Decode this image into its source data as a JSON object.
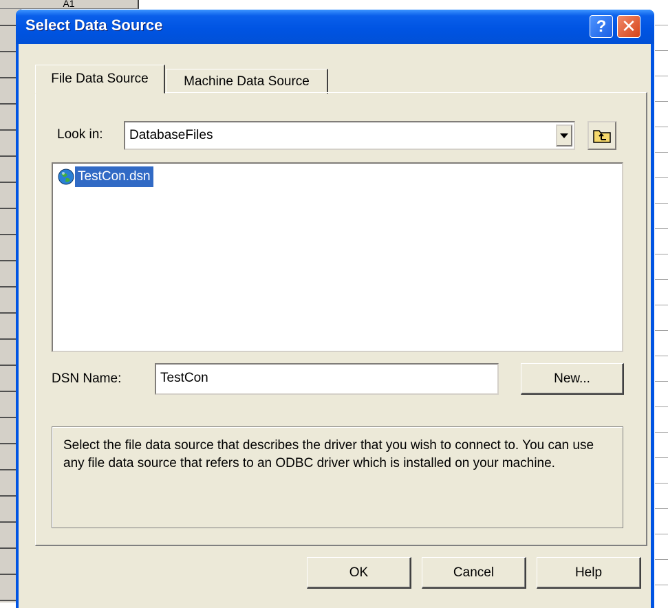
{
  "background": {
    "name_box_text": "A1"
  },
  "dialog": {
    "title": "Select Data Source",
    "help_glyph": "?",
    "close_glyph": "✕",
    "tabs": [
      {
        "label": "File Data Source",
        "selected": true
      },
      {
        "label": "Machine Data Source",
        "selected": false
      }
    ],
    "look_in": {
      "label": "Look in:",
      "value": "DatabaseFiles"
    },
    "file_list": [
      {
        "name": "TestCon.dsn",
        "icon": "globe-dsn-icon",
        "selected": true
      }
    ],
    "dsn_name": {
      "label": "DSN Name:",
      "value": "TestCon"
    },
    "new_button": "New...",
    "description": "Select the file data source that describes the driver that you wish to connect to. You can use any file data source that refers to an ODBC driver which is installed on your machine.",
    "buttons": {
      "ok": "OK",
      "cancel": "Cancel",
      "help": "Help"
    }
  },
  "colors": {
    "titlebar": "#0054e3",
    "dialog_bg": "#ece9d8",
    "selection": "#316ac5"
  }
}
